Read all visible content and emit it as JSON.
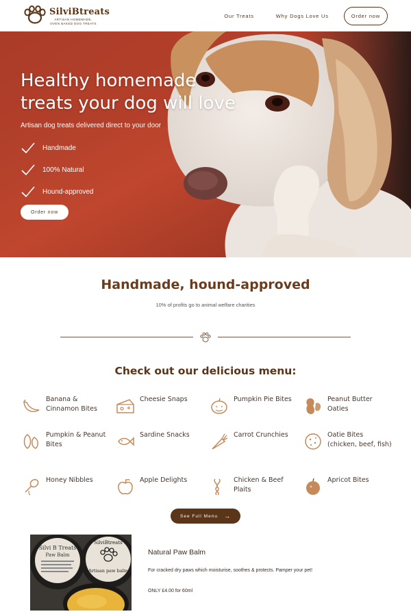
{
  "brand": {
    "name": "SilviBtreats",
    "tagline": "ARTISAN HOMEMADE, OVEN BAKED DOG TREATS"
  },
  "nav": {
    "links": [
      "Our Treats",
      "Why Dogs Love Us"
    ],
    "order_label": "Order now"
  },
  "hero": {
    "title": "Healthy homemade treats your dog will love",
    "subtitle": "Artisan dog treats delivered direct to your door",
    "features": [
      "Handmade",
      "100% Natural",
      "Hound-approved"
    ],
    "button_label": "Order now"
  },
  "intro": {
    "title": "Handmade, hound-approved",
    "subtitle": "10% of profits go to animal welfare charities"
  },
  "menu": {
    "title": "Check out our delicious menu:",
    "items": [
      {
        "label": "Banana & Cinnamon Bites",
        "icon": "banana-icon"
      },
      {
        "label": "Cheesie Snaps",
        "icon": "cheese-icon"
      },
      {
        "label": "Pumpkin Pie Bites",
        "icon": "pumpkin-icon"
      },
      {
        "label": "Peanut Butter Oaties",
        "icon": "peanut-icon"
      },
      {
        "label": "Pumpkin & Peanut Bites",
        "icon": "seeds-icon"
      },
      {
        "label": "Sardine Snacks",
        "icon": "fish-icon"
      },
      {
        "label": "Carrot Crunchies",
        "icon": "carrot-icon"
      },
      {
        "label": "Oatie Bites (chicken, beef, fish)",
        "icon": "cookie-icon"
      },
      {
        "label": "Honey Nibbles",
        "icon": "honey-dipper-icon"
      },
      {
        "label": "Apple Delights",
        "icon": "apple-icon"
      },
      {
        "label": "Chicken & Beef Plaits",
        "icon": "plait-icon"
      },
      {
        "label": "Apricot Bites",
        "icon": "apricot-icon"
      }
    ],
    "see_full_label": "See Full Menu"
  },
  "product": {
    "image_text": {
      "lid_brand": "SilviBtreats",
      "label_name": "Silvi B Treats",
      "label_product": "Paw Balm",
      "side_lid_text": "Artisan paw balm"
    },
    "title": "Natural Paw Balm",
    "description": "For cracked dry paws which moisturise, soothes & protects. Pamper your pet!",
    "price": "ONLY £4.00 for 60ml"
  },
  "colors": {
    "brand_brown": "#5a3518",
    "heading_brown": "#6a3c1c",
    "icon_tan": "#c48a5a",
    "hero_red": "#b8442e"
  }
}
